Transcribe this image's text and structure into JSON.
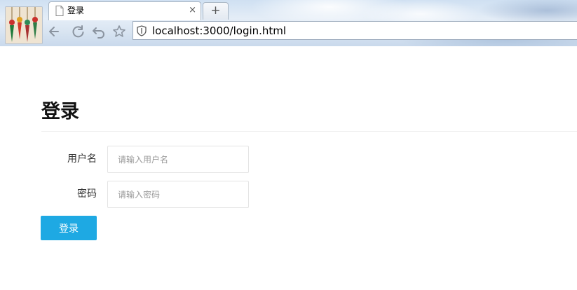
{
  "browser": {
    "tab_title": "登录",
    "close_glyph": "×",
    "new_tab_glyph": "+",
    "address_url": "localhost:3000/login.html",
    "icons": [
      "page-icon",
      "back-icon",
      "reload-icon",
      "undo-icon",
      "star-icon",
      "shield-icon"
    ]
  },
  "page": {
    "title": "登录",
    "form": {
      "username_label": "用户名",
      "username_placeholder": "请输入用户名",
      "username_value": "",
      "password_label": "密码",
      "password_placeholder": "请输入密码",
      "password_value": "",
      "submit_label": "登录"
    }
  },
  "colors": {
    "primary_button": "#1ea9e3",
    "input_border": "#e3e3e3",
    "rule": "#eeeeee"
  }
}
